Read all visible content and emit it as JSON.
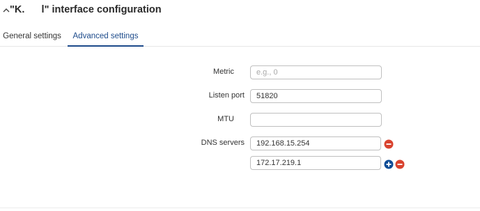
{
  "header": {
    "title": "\"K.      l\" interface configuration"
  },
  "tabs": [
    {
      "label": "General settings"
    },
    {
      "label": "Advanced settings"
    }
  ],
  "form": {
    "metric": {
      "label": "Metric",
      "value": "",
      "placeholder": "e.g., 0"
    },
    "listen_port": {
      "label": "Listen port",
      "value": "51820",
      "placeholder": ""
    },
    "mtu": {
      "label": "MTU",
      "value": "",
      "placeholder": ""
    },
    "dns_servers": {
      "label": "DNS servers",
      "entries": [
        {
          "value": "192.168.15.254"
        },
        {
          "value": "172.17.219.1"
        }
      ]
    }
  },
  "icons": {
    "collapse": "chevron-up-icon",
    "remove": "minus-circle-icon",
    "add": "plus-circle-icon"
  },
  "colors": {
    "accent": "#1c4a8a",
    "remove": "#d9432f",
    "add": "#0f4c96"
  }
}
